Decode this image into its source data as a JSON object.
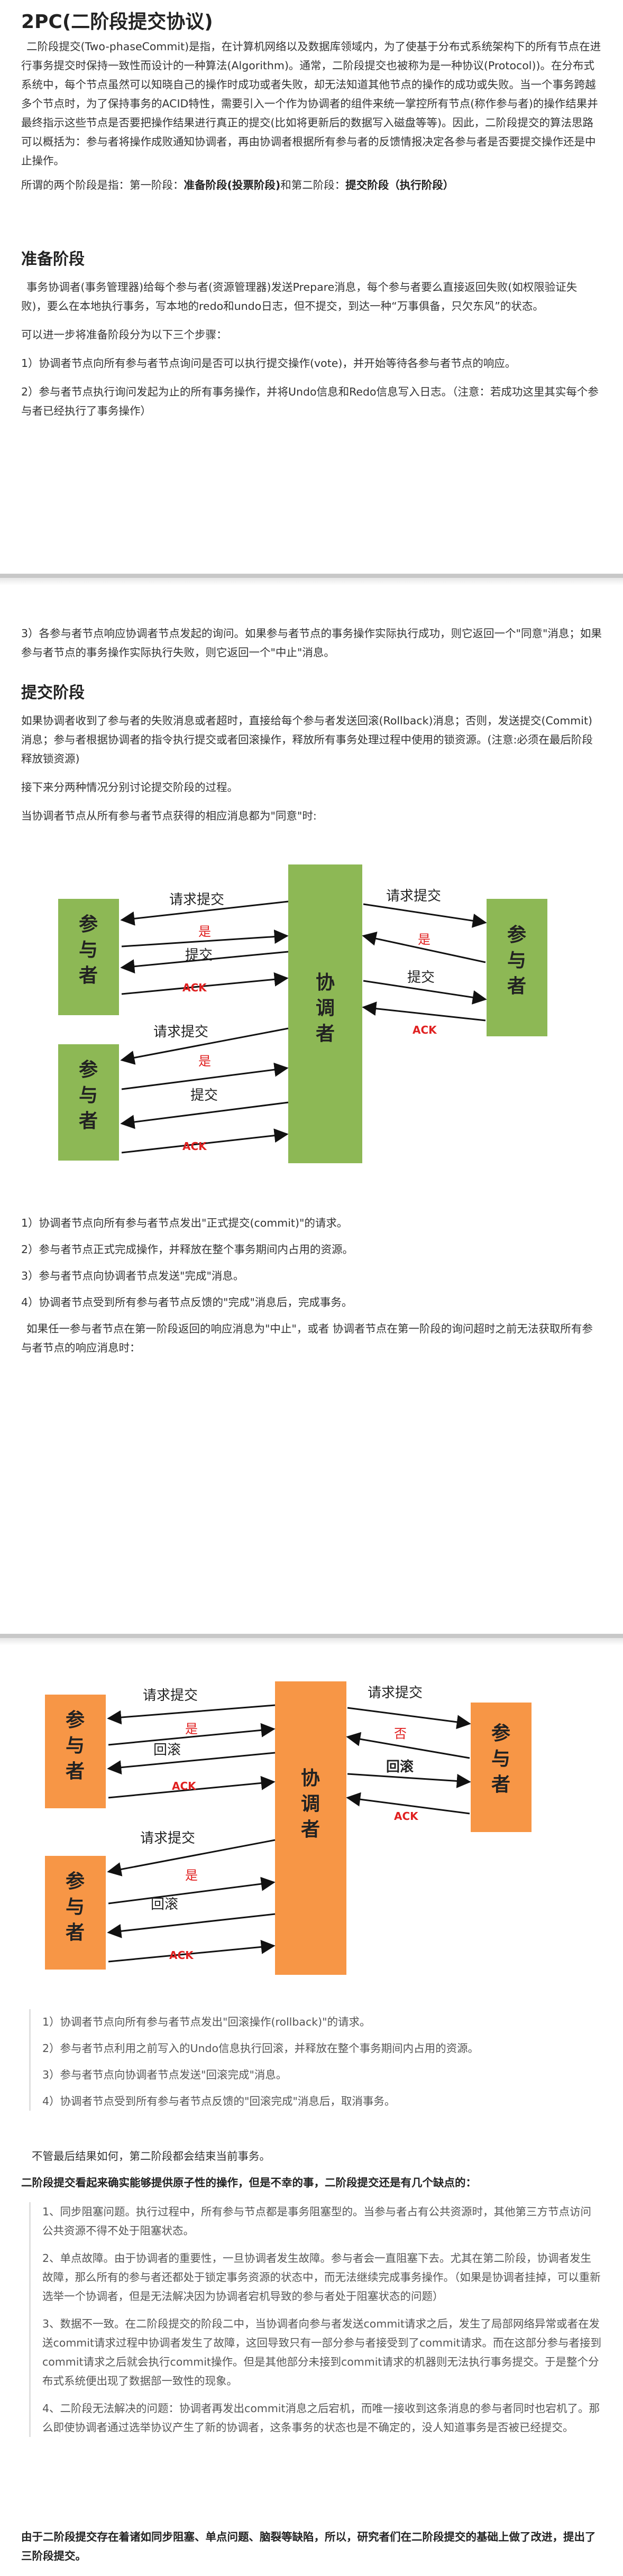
{
  "title": "2PC(二阶段提交协议)",
  "intro": {
    "text": "二阶段提交(Two-phaseCommit)是指，在计算机网络以及数据库领域内，为了使基于分布式系统架构下的所有节点在进行事务提交时保持一致性而设计的一种算法(Algorithm)。通常，二阶段提交也被称为是一种协议(Protocol))。在分布式系统中，每个节点虽然可以知晓自己的操作时成功或者失败，却无法知道其他节点的操作的成功或失败。当一个事务跨越多个节点时，为了保持事务的ACID特性，需要引入一个作为协调者的组件来统一掌控所有节点(称作参与者)的操作结果并最终指示这些节点是否要把操作结果进行真正的提交(比如将更新后的数据写入磁盘等等)。因此，二阶段提交的算法思路可以概括为：参与者将操作成败通知协调者，再由协调者根据所有参与者的反馈情报决定各参与者是否要提交操作还是中止操作。",
    "phases_prefix": "所谓的两个阶段是指：第一阶段：",
    "phase1": "准备阶段(投票阶段)",
    "phases_mid": "和第二阶段：",
    "phase2": "提交阶段（执行阶段）"
  },
  "prepare": {
    "heading": "准备阶段",
    "p1": "事务协调者(事务管理器)给每个参与者(资源管理器)发送Prepare消息，每个参与者要么直接返回失败(如权限验证失败)，要么在本地执行事务，写本地的redo和undo日志，但不提交，到达一种“万事俱备，只欠东风”的状态。",
    "p2": "可以进一步将准备阶段分为以下三个步骤：",
    "s1": "1）协调者节点向所有参与者节点询问是否可以执行提交操作(vote)，并开始等待各参与者节点的响应。",
    "s2": "2）参与者节点执行询问发起为止的所有事务操作，并将Undo信息和Redo信息写入日志。（注意：若成功这里其实每个参与者已经执行了事务操作）",
    "s3": "3）各参与者节点响应协调者节点发起的询问。如果参与者节点的事务操作实际执行成功，则它返回一个\"同意\"消息；如果参与者节点的事务操作实际执行失败，则它返回一个\"中止\"消息。"
  },
  "commit": {
    "heading": "提交阶段",
    "p1": "如果协调者收到了参与者的失败消息或者超时，直接给每个参与者发送回滚(Rollback)消息；否则，发送提交(Commit)消息；参与者根据协调者的指令执行提交或者回滚操作，释放所有事务处理过程中使用的锁资源。(注意:必须在最后阶段释放锁资源)",
    "p2": "接下来分两种情况分别讨论提交阶段的过程。",
    "p3": "当协调者节点从所有参与者节点获得的相应消息都为\"同意\"时:",
    "c1": "1）协调者节点向所有参与者节点发出\"正式提交(commit)\"的请求。",
    "c2": "2）参与者节点正式完成操作，并释放在整个事务期间内占用的资源。",
    "c3": "3）参与者节点向协调者节点发送\"完成\"消息。",
    "c4": "4）协调者节点受到所有参与者节点反馈的\"完成\"消息后，完成事务。",
    "p4": "如果任一参与者节点在第一阶段返回的响应消息为\"中止\"，或者 协调者节点在第一阶段的询问超时之前无法获取所有参与者节点的响应消息时：",
    "r1": "1）协调者节点向所有参与者节点发出\"回滚操作(rollback)\"的请求。",
    "r2": "2）参与者节点利用之前写入的Undo信息执行回滚，并释放在整个事务期间内占用的资源。",
    "r3": "3）参与者节点向协调者节点发送\"回滚完成\"消息。",
    "r4": "4）协调者节点受到所有参与者节点反馈的\"回滚完成\"消息后，取消事务。",
    "p5": "不管最后结果如何，第二阶段都会结束当前事务。"
  },
  "diagram1": {
    "participant": "参与者",
    "coordinator": "协调者",
    "request": "请求提交",
    "yes": "是",
    "commit": "提交",
    "ack": "ACK",
    "colors": {
      "box": "#8DB855",
      "text": "#222222",
      "red": "#E02020"
    }
  },
  "diagram2": {
    "participant": "参与者",
    "coordinator": "协调者",
    "request": "请求提交",
    "yes": "是",
    "no": "否",
    "rollback": "回滚",
    "ack": "ACK",
    "colors": {
      "box": "#F79646",
      "text": "#222222",
      "red": "#E02020"
    }
  },
  "drawbacks": {
    "intro": "二阶段提交看起来确实能够提供原子性的操作，但是不幸的事，二阶段提交还是有几个缺点的：",
    "d1": "1、同步阻塞问题。执行过程中，所有参与节点都是事务阻塞型的。当参与者占有公共资源时，其他第三方节点访问公共资源不得不处于阻塞状态。",
    "d2": "2、单点故障。由于协调者的重要性，一旦协调者发生故障。参与者会一直阻塞下去。尤其在第二阶段，协调者发生故障，那么所有的参与者还都处于锁定事务资源的状态中，而无法继续完成事务操作。（如果是协调者挂掉，可以重新选举一个协调者，但是无法解决因为协调者宕机导致的参与者处于阻塞状态的问题）",
    "d3": "3、数据不一致。在二阶段提交的阶段二中，当协调者向参与者发送commit请求之后，发生了局部网络异常或者在发送commit请求过程中协调者发生了故障，这回导致只有一部分参与者接受到了commit请求。而在这部分参与者接到commit请求之后就会执行commit操作。但是其他部分未接到commit请求的机器则无法执行事务提交。于是整个分布式系统便出现了数据部一致性的现象。",
    "d4": "4、二阶段无法解决的问题：协调者再发出commit消息之后宕机，而唯一接收到这条消息的参与者同时也宕机了。那么即使协调者通过选举协议产生了新的协调者，这条事务的状态也是不确定的，没人知道事务是否被已经提交。",
    "outro": "由于二阶段提交存在着诸如同步阻塞、单点问题、脑裂等缺陷，所以，研究者们在二阶段提交的基础上做了改进，提出了三阶段提交。"
  }
}
